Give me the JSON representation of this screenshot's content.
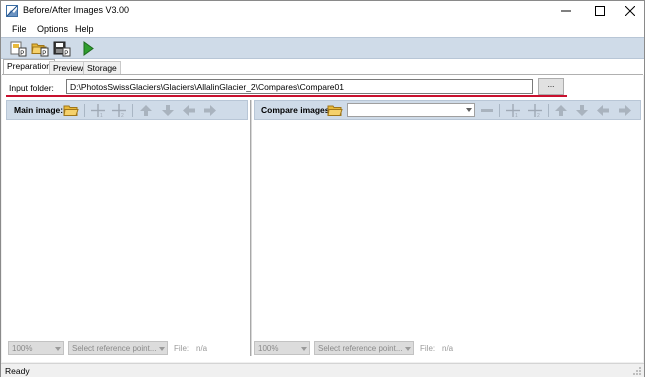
{
  "window": {
    "title": "Before/After Images V3.00"
  },
  "menu": {
    "items": [
      "File",
      "Options",
      "Help"
    ]
  },
  "toolbar": {
    "icons": [
      "new-project-icon",
      "open-project-icon",
      "save-project-icon",
      "run-icon"
    ]
  },
  "tabs": {
    "items": [
      "Preparation",
      "Preview",
      "Storage"
    ],
    "active": "Preparation"
  },
  "preparation": {
    "input_folder_label": "Input folder:",
    "input_folder_value": "D:\\PhotosSwissGlaciers\\Glaciers\\AllalinGlacier_2\\Compares\\Compare01",
    "browse_label": "..."
  },
  "main_pane": {
    "label": "Main image:",
    "zoom": "100%",
    "ref_placeholder": "Select reference point...",
    "file_label": "File:",
    "file_value": "n/a"
  },
  "compare_pane": {
    "label": "Compare images:",
    "select_value": "",
    "zoom": "100%",
    "ref_placeholder": "Select reference point...",
    "file_label": "File:",
    "file_value": "n/a"
  },
  "status": {
    "text": "Ready"
  },
  "colors": {
    "accent_line": "#c8102e",
    "toolbar_bg": "#cfdbe8"
  }
}
